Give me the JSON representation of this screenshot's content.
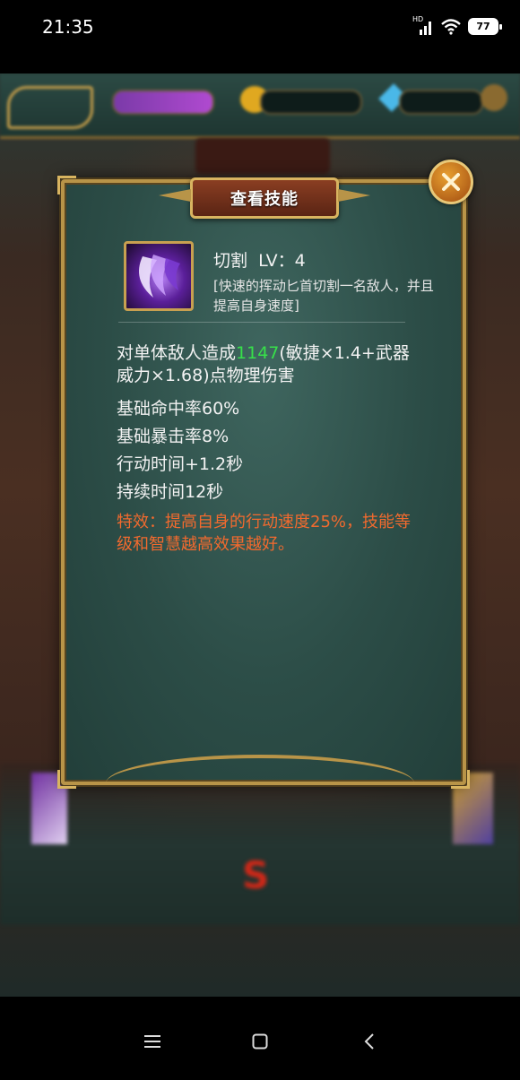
{
  "status_bar": {
    "time": "21:35",
    "network": "HD",
    "battery": "77"
  },
  "dialog": {
    "title": "查看技能",
    "skill": {
      "name": "切割",
      "level": "LV：4",
      "description": "[快速的挥动匕首切割一名敌人，并且提高自身速度]"
    },
    "damage": {
      "prefix": "对单体敌人造成",
      "value": "1147",
      "suffix": "(敏捷×1.4+武器威力×1.68)点物理伤害"
    },
    "stats": [
      "基础命中率60%",
      "基础暴击率8%",
      "行动时间+1.2秒",
      "持续时间12秒"
    ],
    "special": "特效：提高自身的行动速度25%，技能等级和智慧越高效果越好。"
  },
  "colors": {
    "highlight": "#37e04a",
    "special": "#f26a2e",
    "frame": "#b89448"
  },
  "icons": {
    "close": "close-x-icon",
    "skill": "slash-skill-icon"
  }
}
